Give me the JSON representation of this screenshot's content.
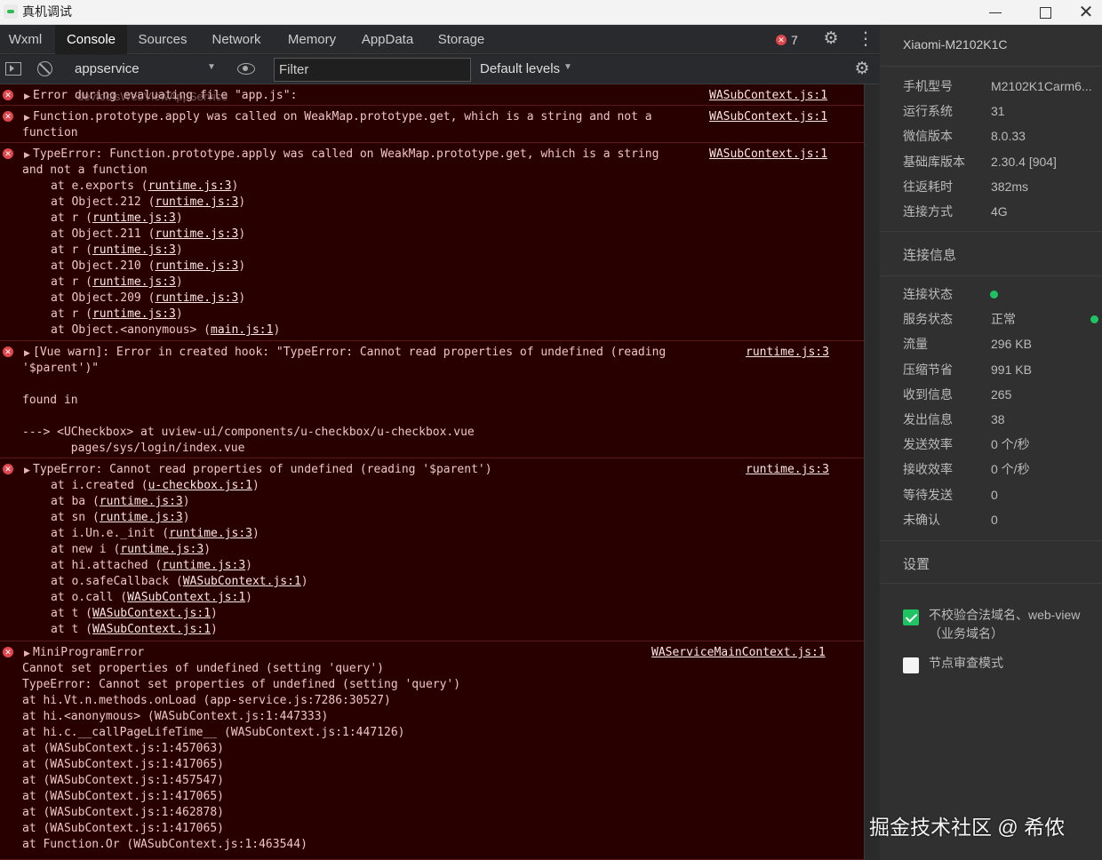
{
  "window": {
    "title": "真机调试"
  },
  "tabs": [
    "Wxml",
    "Console",
    "Sources",
    "Network",
    "Memory",
    "AppData",
    "Storage"
  ],
  "active_tab": "Console",
  "error_count": "7",
  "toolbar": {
    "context": "appservice",
    "filter_placeholder": "Filter",
    "levels": "Default levels"
  },
  "overlay_text": "devtoolsWebViewAppService",
  "messages": [
    {
      "lines": [
        "Error during evaluating file \"app.js\":"
      ],
      "source": "WASubContext.js:1"
    },
    {
      "lines": [
        "Function.prototype.apply was called on WeakMap.prototype.get, which is a string and not a",
        "function"
      ],
      "source": "WASubContext.js:1"
    },
    {
      "lines": [
        "TypeError: Function.prototype.apply was called on WeakMap.prototype.get, which is a string",
        "and not a function"
      ],
      "source": "WASubContext.js:1",
      "frames": [
        [
          "at e.exports (",
          "runtime.js:3",
          ")"
        ],
        [
          "at Object.212 (",
          "runtime.js:3",
          ")"
        ],
        [
          "at r (",
          "runtime.js:3",
          ")"
        ],
        [
          "at Object.211 (",
          "runtime.js:3",
          ")"
        ],
        [
          "at r (",
          "runtime.js:3",
          ")"
        ],
        [
          "at Object.210 (",
          "runtime.js:3",
          ")"
        ],
        [
          "at r (",
          "runtime.js:3",
          ")"
        ],
        [
          "at Object.209 (",
          "runtime.js:3",
          ")"
        ],
        [
          "at r (",
          "runtime.js:3",
          ")"
        ],
        [
          "at Object.<anonymous> (",
          "main.js:1",
          ")"
        ]
      ]
    },
    {
      "lines": [
        "[Vue warn]: Error in created hook: \"TypeError: Cannot read properties of undefined (reading",
        "'$parent')\"",
        "",
        "found in",
        "",
        "---> <UCheckbox> at uview-ui/components/u-checkbox/u-checkbox.vue",
        "       pages/sys/login/index.vue"
      ],
      "source": "runtime.js:3"
    },
    {
      "lines": [
        "TypeError: Cannot read properties of undefined (reading '$parent')"
      ],
      "source": "runtime.js:3",
      "frames": [
        [
          "at i.created (",
          "u-checkbox.js:1",
          ")"
        ],
        [
          "at ba (",
          "runtime.js:3",
          ")"
        ],
        [
          "at sn (",
          "runtime.js:3",
          ")"
        ],
        [
          "at i.Un.e._init (",
          "runtime.js:3",
          ")"
        ],
        [
          "at new i (",
          "runtime.js:3",
          ")"
        ],
        [
          "at hi.attached (",
          "runtime.js:3",
          ")"
        ],
        [
          "at o.safeCallback (",
          "WASubContext.js:1",
          ")"
        ],
        [
          "at o.call (",
          "WASubContext.js:1",
          ")"
        ],
        [
          "at t (",
          "WASubContext.js:1",
          ")"
        ],
        [
          "at t (",
          "WASubContext.js:1",
          ")"
        ]
      ]
    },
    {
      "lines": [
        "MiniProgramError",
        "Cannot set properties of undefined (setting 'query')",
        "TypeError: Cannot set properties of undefined (setting 'query')",
        "at hi.Vt.n.methods.onLoad (app-service.js:7286:30527)",
        "at hi.<anonymous> (WASubContext.js:1:447333)",
        "at hi.c.__callPageLifeTime__ (WASubContext.js:1:447126)",
        "at (WASubContext.js:1:457063)",
        "at (WASubContext.js:1:417065)",
        "at (WASubContext.js:1:457547)",
        "at (WASubContext.js:1:417065)",
        "at (WASubContext.js:1:462878)",
        "at (WASubContext.js:1:417065)",
        "at Function.Or (WASubContext.js:1:463544)"
      ],
      "source": "WAServiceMainContext.js:1"
    }
  ],
  "side": {
    "device": "Xiaomi-M2102K1C",
    "info": [
      {
        "k": "手机型号",
        "v": "M2102K1Carm6..."
      },
      {
        "k": "运行系统",
        "v": "31"
      },
      {
        "k": "微信版本",
        "v": "8.0.33"
      },
      {
        "k": "基础库版本",
        "v": "2.30.4 [904]"
      },
      {
        "k": "往返耗时",
        "v": "382ms"
      },
      {
        "k": "连接方式",
        "v": "4G"
      }
    ],
    "conn_header": "连接信息",
    "conn": [
      {
        "k": "连接状态",
        "v": ""
      },
      {
        "k": "服务状态",
        "v": "正常"
      },
      {
        "k": "流量",
        "v": "296 KB"
      },
      {
        "k": "压缩节省",
        "v": "991 KB"
      },
      {
        "k": "收到信息",
        "v": "265"
      },
      {
        "k": "发出信息",
        "v": "38"
      },
      {
        "k": "发送效率",
        "v": "0 个/秒"
      },
      {
        "k": "接收效率",
        "v": "0 个/秒"
      },
      {
        "k": "等待发送",
        "v": "0"
      },
      {
        "k": "未确认",
        "v": "0"
      }
    ],
    "settings_header": "设置",
    "settings": [
      {
        "label": "不校验合法域名、web-view（业务域名）",
        "checked": true
      },
      {
        "label": "节点审查模式",
        "checked": false
      }
    ]
  },
  "watermark": "掘金技术社区 @ 希侬",
  "colors": {
    "console_bg": "#280000",
    "error_red": "#e0474c",
    "status_green": "#1fc363"
  }
}
